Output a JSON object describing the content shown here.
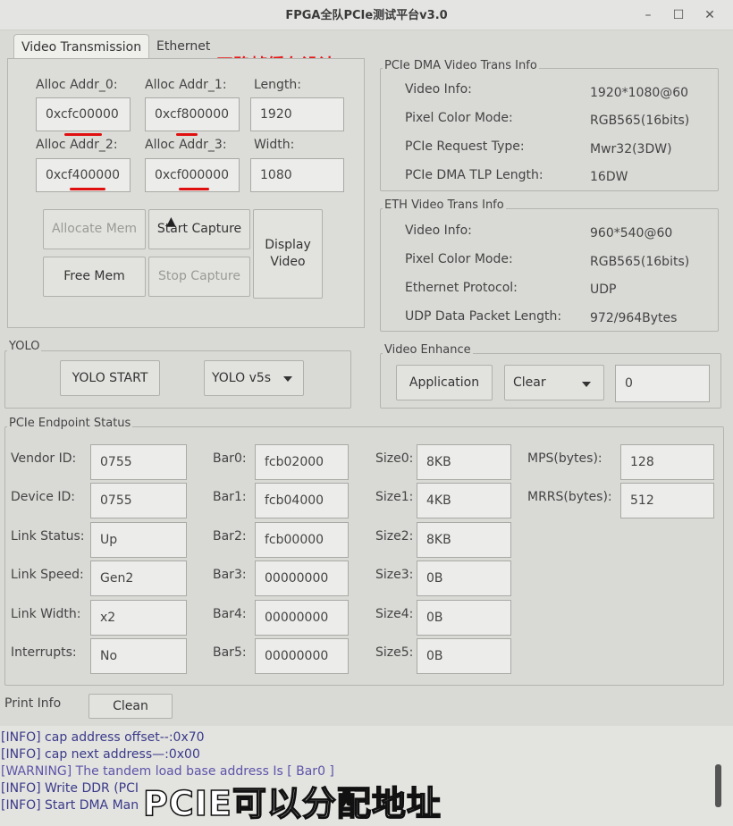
{
  "window": {
    "title": "FPGA全队PCIe测试平台v3.0"
  },
  "tabs": [
    "Video Transmission",
    "Ethernet"
  ],
  "overlay_caption": "四路帧缓存设计",
  "alloc": {
    "addr0_label": "Alloc Addr_0:",
    "addr0_value": "0xcfc00000",
    "addr1_label": "Alloc Addr_1:",
    "addr1_value": "0xcf800000",
    "length_label": "Length:",
    "length_value": "1920",
    "addr2_label": "Alloc Addr_2:",
    "addr2_value": "0xcf400000",
    "addr3_label": "Alloc Addr_3:",
    "addr3_value": "0xcf000000",
    "width_label": "Width:",
    "width_value": "1080"
  },
  "buttons": {
    "allocate_mem": "Allocate Mem",
    "start_capture": "Start Capture",
    "display_video_1": "Display",
    "display_video_2": "Video",
    "free_mem": "Free Mem",
    "stop_capture": "Stop Capture"
  },
  "pcie_dma": {
    "title": "PCIe DMA Video Trans Info",
    "rows": [
      {
        "label": "Video Info:",
        "value": "1920*1080@60"
      },
      {
        "label": "Pixel Color Mode:",
        "value": "RGB565(16bits)"
      },
      {
        "label": "PCIe Request Type:",
        "value": "Mwr32(3DW)"
      },
      {
        "label": "PCIe DMA TLP Length:",
        "value": "16DW"
      }
    ]
  },
  "eth": {
    "title": "ETH Video Trans Info",
    "rows": [
      {
        "label": "Video Info:",
        "value": "960*540@60"
      },
      {
        "label": "Pixel Color Mode:",
        "value": "RGB565(16bits)"
      },
      {
        "label": "Ethernet Protocol:",
        "value": "UDP"
      },
      {
        "label": "UDP Data Packet Length:",
        "value": "972/964Bytes"
      }
    ]
  },
  "yolo": {
    "title": "YOLO",
    "start": "YOLO START",
    "model": "YOLO v5s"
  },
  "enhance": {
    "title": "Video Enhance",
    "apply": "Application",
    "mode": "Clear",
    "value": "0"
  },
  "endpoint": {
    "title": "PCIe Endpoint Status",
    "col1": [
      {
        "label": "Vendor ID:",
        "value": "0755"
      },
      {
        "label": "Device ID:",
        "value": "0755"
      },
      {
        "label": "Link Status:",
        "value": "Up"
      },
      {
        "label": "Link Speed:",
        "value": "Gen2"
      },
      {
        "label": "Link Width:",
        "value": "x2"
      },
      {
        "label": "Interrupts:",
        "value": "No"
      }
    ],
    "col2": [
      {
        "label": "Bar0:",
        "value": "fcb02000"
      },
      {
        "label": "Bar1:",
        "value": "fcb04000"
      },
      {
        "label": "Bar2:",
        "value": "fcb00000"
      },
      {
        "label": "Bar3:",
        "value": "00000000"
      },
      {
        "label": "Bar4:",
        "value": "00000000"
      },
      {
        "label": "Bar5:",
        "value": "00000000"
      }
    ],
    "col3": [
      {
        "label": "Size0:",
        "value": "8KB"
      },
      {
        "label": "Size1:",
        "value": "4KB"
      },
      {
        "label": "Size2:",
        "value": "8KB"
      },
      {
        "label": "Size3:",
        "value": "0B"
      },
      {
        "label": "Size4:",
        "value": "0B"
      },
      {
        "label": "Size5:",
        "value": "0B"
      }
    ],
    "col4": [
      {
        "label": "MPS(bytes):",
        "value": "128"
      },
      {
        "label": "MRRS(bytes):",
        "value": "512"
      }
    ]
  },
  "print_info": {
    "label": "Print Info",
    "clean": "Clean"
  },
  "log": [
    {
      "text": "[INFO] cap address offset--:0x70",
      "color": "#3a3a8a"
    },
    {
      "text": "[INFO] cap next address—:0x00",
      "color": "#3a3a8a"
    },
    {
      "text": "[WARNING] The tandem load base address Is [ Bar0 ]",
      "color": "#5c54a8"
    },
    {
      "text": "[INFO] Write DDR (PCI",
      "color": "#3a3a8a"
    },
    {
      "text": "[INFO] Start DMA Man",
      "color": "#3a3a8a"
    }
  ],
  "video_subtitle": "PCIE可以分配地址"
}
